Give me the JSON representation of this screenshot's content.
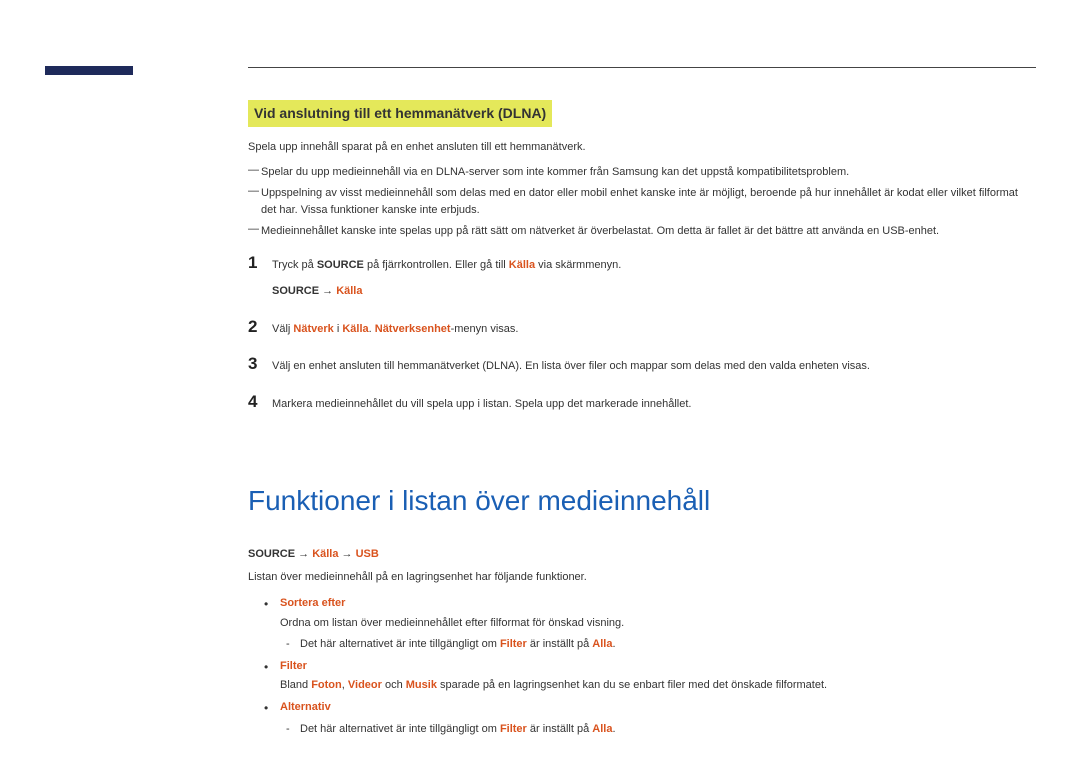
{
  "section1": {
    "title": "Vid anslutning till ett hemmanätverk (DLNA)",
    "intro": "Spela upp innehåll sparat på en enhet ansluten till ett hemmanätverk.",
    "notes": [
      "Spelar du upp medieinnehåll via en DLNA-server som inte kommer från Samsung kan det uppstå kompatibilitetsproblem.",
      "Uppspelning av visst medieinnehåll som delas med en dator eller mobil enhet kanske inte är möjligt, beroende på hur innehållet är kodat eller vilket filformat det har. Vissa funktioner kanske inte erbjuds.",
      "Medieinnehållet kanske inte spelas upp på rätt sätt om nätverket är överbelastat. Om detta är fallet är det bättre att använda en USB-enhet."
    ],
    "steps": [
      {
        "num": "1",
        "pre": "Tryck på ",
        "bold1": "SOURCE",
        "mid": " på fjärrkontrollen. Eller gå till ",
        "red1": "Källa",
        "post": " via skärmmenyn.",
        "navSourceLabel": "SOURCE",
        "navArrow": " → ",
        "navKalla": "Källa"
      },
      {
        "num": "2",
        "pre": "Välj ",
        "red1": "Nätverk",
        "mid1": " i ",
        "red2": "Källa",
        "mid2": ". ",
        "red3": "Nätverksenhet",
        "post": "-menyn visas."
      },
      {
        "num": "3",
        "text": "Välj en enhet ansluten till hemmanätverket (DLNA). En lista över filer och mappar som delas med den valda enheten visas."
      },
      {
        "num": "4",
        "text": "Markera medieinnehållet du vill spela upp i listan. Spela upp det markerade innehållet."
      }
    ]
  },
  "section2": {
    "title": "Funktioner i listan över medieinnehåll",
    "navSourceLabel": "SOURCE",
    "navArrow1": " → ",
    "navKalla": "Källa",
    "navArrow2": " → ",
    "navUsb": "USB",
    "desc": "Listan över medieinnehåll på en lagringsenhet har följande funktioner.",
    "bullets": [
      {
        "title": "Sortera efter",
        "desc": "Ordna om listan över medieinnehållet efter filformat för önskad visning.",
        "subPre": "Det här alternativet är inte tillgängligt om ",
        "subRed1": "Filter",
        "subMid": " är inställt på ",
        "subRed2": "Alla",
        "subPost": "."
      },
      {
        "title": "Filter",
        "descPre": "Bland ",
        "descRed1": "Foton",
        "descMid1": ", ",
        "descRed2": "Videor",
        "descMid2": " och ",
        "descRed3": "Musik",
        "descPost": " sparade på en lagringsenhet kan du se enbart filer med det önskade filformatet."
      },
      {
        "title": "Alternativ",
        "subPre": "Det här alternativet är inte tillgängligt om ",
        "subRed1": "Filter",
        "subMid": " är inställt på ",
        "subRed2": "Alla",
        "subPost": "."
      }
    ]
  }
}
